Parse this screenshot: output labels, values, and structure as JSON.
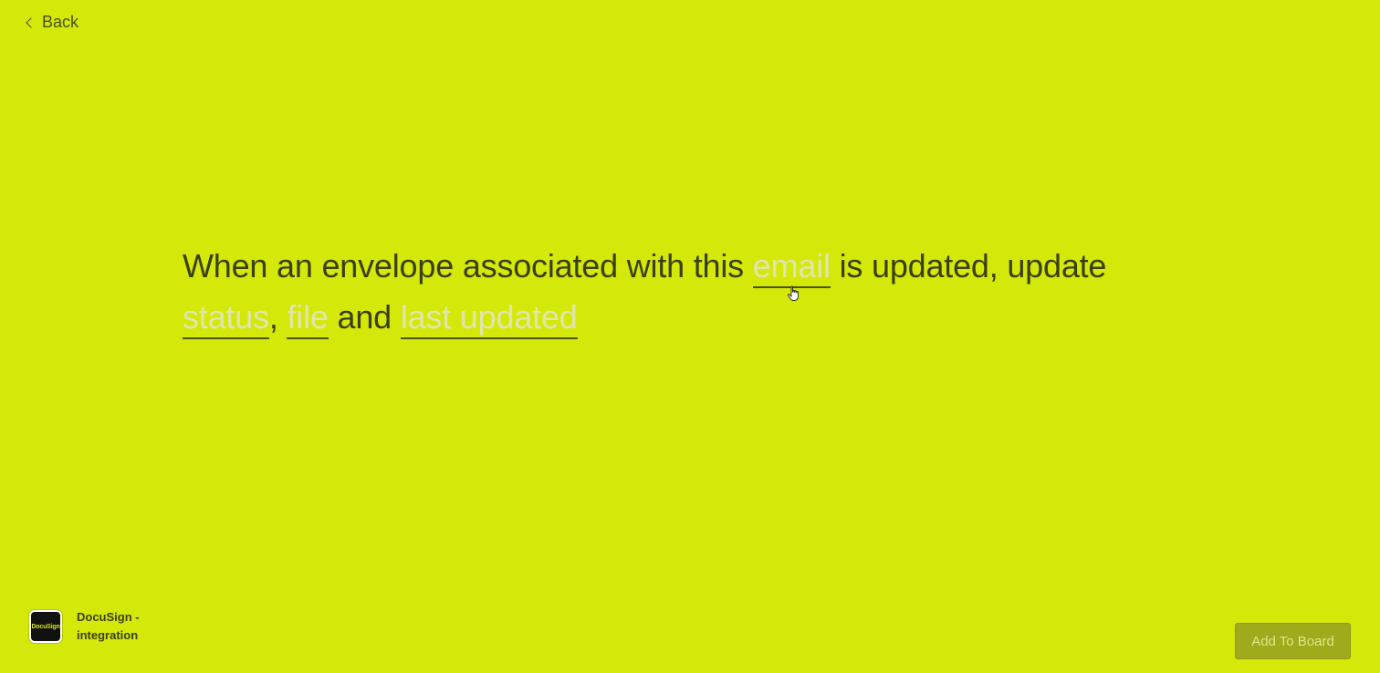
{
  "nav": {
    "back_label": "Back"
  },
  "recipe": {
    "part1": "When an envelope associated with this ",
    "slot_email": "email",
    "part2": " is updated, update ",
    "slot_status": "status",
    "comma": ", ",
    "slot_file": "file",
    "part3": " and ",
    "slot_last_updated": "last updated"
  },
  "integration": {
    "logo_text": "DocuSign",
    "name_line1": "DocuSign -",
    "name_line2": "integration"
  },
  "actions": {
    "add_to_board": "Add To Board"
  },
  "colors": {
    "background": "#d4e80a",
    "button_bg": "#9fab1b",
    "placeholder_text": "#e0e6ae"
  },
  "icons": {
    "back": "chevron-left-icon",
    "cursor": "hand-pointer-icon"
  }
}
